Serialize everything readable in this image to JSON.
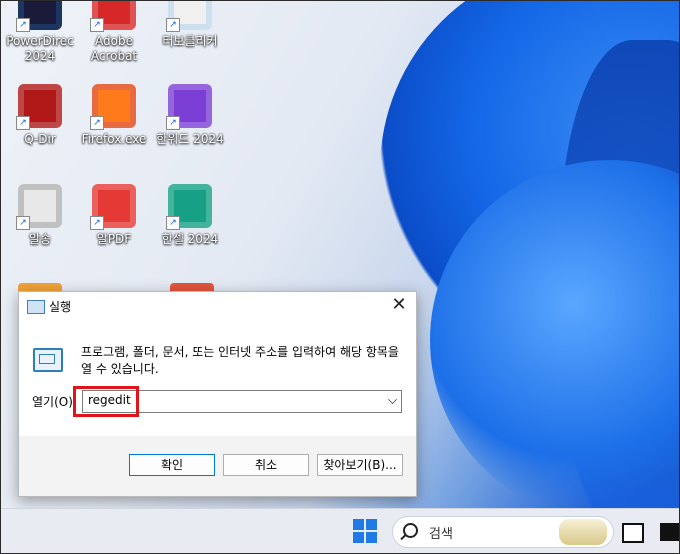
{
  "desktop_icons": [
    {
      "label": "PowerDirec\n2024",
      "color": "#1a1a3a",
      "accent": "#2ea4ff"
    },
    {
      "label": "Adobe\nAcrobat",
      "color": "#d62828",
      "accent": "#ffffff"
    },
    {
      "label": "터보클리커",
      "color": "#f0f0f0",
      "accent": "#3aa0f0"
    },
    {
      "label": "Q-Dir",
      "color": "#b01818",
      "accent": "#ffffff"
    },
    {
      "label": "Firefox.exe",
      "color": "#ff7a1a",
      "accent": "#8a2be2"
    },
    {
      "label": "한워드 2024",
      "color": "#7b3fd6",
      "accent": "#ffffff"
    },
    {
      "label": "알송",
      "color": "#e8e8e8",
      "accent": "#222222"
    },
    {
      "label": "알PDF",
      "color": "#e53935",
      "accent": "#ffffff"
    },
    {
      "label": "한셀 2024",
      "color": "#16a085",
      "accent": "#ffffff"
    }
  ],
  "run_dialog": {
    "title": "실행",
    "description": "프로그램, 폴더, 문서, 또는 인터넷 주소를 입력하여 해당 항목을 열 수 있습니다.",
    "open_label": "열기(O):",
    "input_value": "regedit",
    "ok_label": "확인",
    "cancel_label": "취소",
    "browse_label": "찾아보기(B)...",
    "close_symbol": "✕"
  },
  "taskbar": {
    "search_placeholder": "검색"
  },
  "colors": {
    "highlight_box": "#e0141a",
    "accent": "#0078d7"
  }
}
